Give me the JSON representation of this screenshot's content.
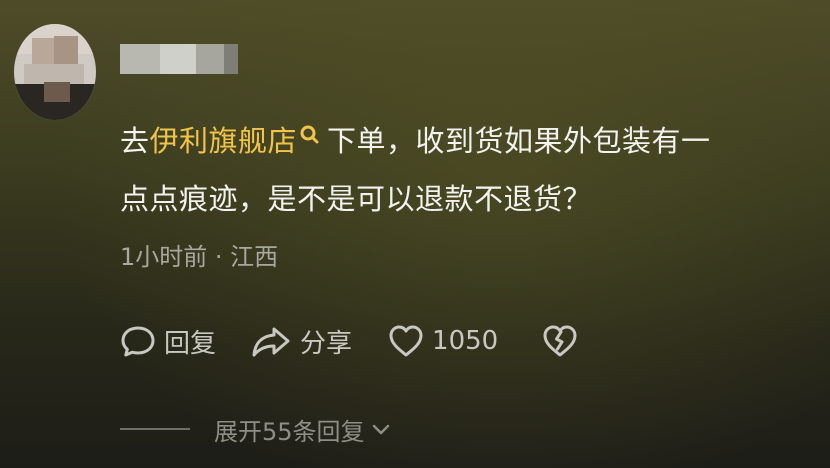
{
  "comment": {
    "prefix": "去",
    "link_text": "伊利旗舰店",
    "link_icon": "search-icon",
    "body_line1": "下单，收到货如果外包装有一",
    "body_line2": "点点痕迹，是不是可以退款不退货？",
    "meta": "1小时前 · 江西"
  },
  "actions": {
    "reply_label": "回复",
    "share_label": "分享",
    "like_count": "1050",
    "dislike_icon": "broken-heart-icon"
  },
  "replies": {
    "expand_label": "展开55条回复"
  },
  "colors": {
    "link": "#f0c44a",
    "text": "#f2f2ee",
    "meta": "#a8a8a0"
  }
}
